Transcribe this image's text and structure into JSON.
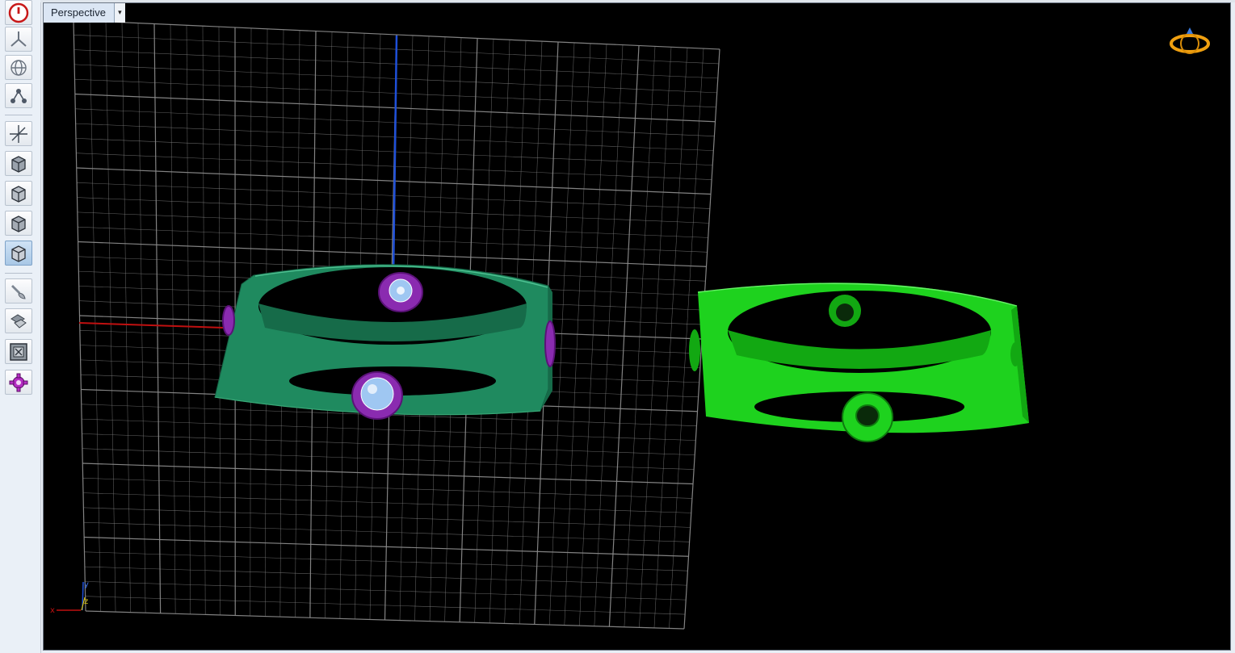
{
  "viewport": {
    "view_name": "Perspective",
    "dropdown_glyph": "▾",
    "background": "#000000",
    "grid_color": "#8a8a8a",
    "axis_x_color": "#c01010",
    "axis_z_color": "#1e4fd8"
  },
  "axis_triad": {
    "x_label": "x",
    "y_label": "y",
    "z_label": "z"
  },
  "toolbar": {
    "items": [
      {
        "icon": "power-icon"
      },
      {
        "icon": "pivot-icon"
      },
      {
        "icon": "globe-icon"
      },
      {
        "icon": "nodes-icon"
      },
      {
        "icon": "move-axes-icon"
      },
      {
        "icon": "cube-view-icon"
      },
      {
        "icon": "cube-front-icon"
      },
      {
        "icon": "cube-side-icon"
      },
      {
        "icon": "cube-perspective-icon",
        "active": true
      },
      {
        "icon": "paint-brush-icon"
      },
      {
        "icon": "render-icon"
      },
      {
        "icon": "maximize-icon"
      },
      {
        "icon": "settings-gear-icon"
      }
    ]
  },
  "objects": {
    "ring_left_color": "#1f8a5f",
    "ring_right_color": "#1ed21e",
    "gem_setting_color": "#8a2bb0",
    "gem_color": "#9fc7f2"
  }
}
